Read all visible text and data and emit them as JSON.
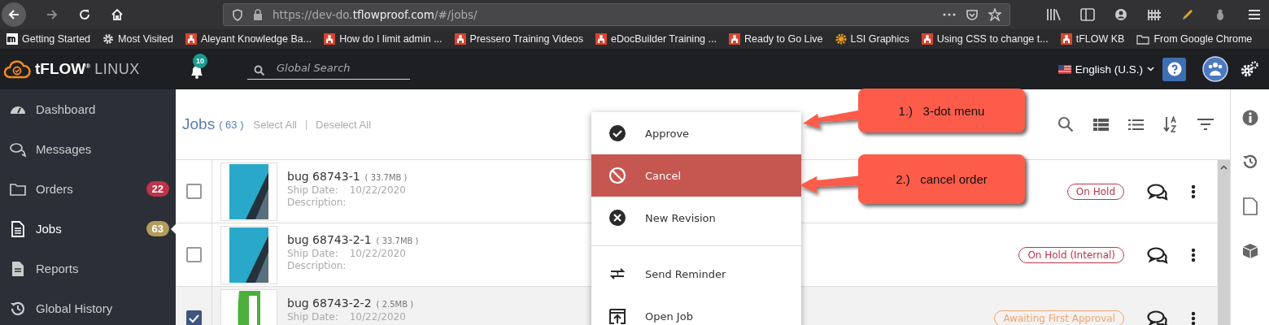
{
  "browser": {
    "url_prefix": "https://dev-do.",
    "url_domain": "tflowproof.com",
    "url_suffix": "/#/jobs/"
  },
  "bookmarks": [
    {
      "label": "Getting Started"
    },
    {
      "label": "Most Visited"
    },
    {
      "label": "Aleyant Knowledge Ba..."
    },
    {
      "label": "How do I limit admin ..."
    },
    {
      "label": "Pressero Training Videos"
    },
    {
      "label": "eDocBuilder Training ..."
    },
    {
      "label": "Ready to Go Live"
    },
    {
      "label": "LSI Graphics"
    },
    {
      "label": "Using CSS to change t..."
    },
    {
      "label": "tFLOW KB"
    },
    {
      "label": "From Google Chrome"
    }
  ],
  "app_header": {
    "logo": "tFLOW",
    "logo_mark": "®",
    "product": "LINUX",
    "notifications": "10",
    "search_placeholder": "Global Search",
    "language": "English (U.S.)"
  },
  "sidebar": {
    "items": [
      {
        "label": "Dashboard",
        "selected": false
      },
      {
        "label": "Messages",
        "selected": false
      },
      {
        "label": "Orders",
        "badge": "22",
        "color": "#c0334a",
        "selected": false
      },
      {
        "label": "Jobs",
        "badge": "63",
        "color": "#b39c5a",
        "selected": true
      },
      {
        "label": "Reports",
        "selected": false
      },
      {
        "label": "Global History",
        "selected": false
      }
    ]
  },
  "jobs": {
    "title": "Jobs",
    "count": "( 63 )",
    "select_all": "Select All",
    "separator": "|",
    "deselect_all": "Deselect All",
    "rows": [
      {
        "checked": false,
        "name": "bug 68743-1",
        "size": "( 33.7MB )",
        "ship_label": "Ship Date:",
        "ship_date": "10/22/2020",
        "description_label": "Description:",
        "status": "On Hold",
        "color": "#c0334a"
      },
      {
        "checked": false,
        "name": "bug 68743-2-1",
        "size": "( 33.7MB )",
        "ship_label": "Ship Date:",
        "ship_date": "10/22/2020",
        "description_label": "Description:",
        "status": "On Hold (Internal)",
        "color": "#c0334a"
      },
      {
        "checked": true,
        "name": "bug 68743-2-2",
        "size": "( 2.5MB )",
        "ship_label": "Ship Date:",
        "ship_date": "10/22/2020",
        "status": "Awaiting First Approval",
        "color": "#f2a46b"
      }
    ]
  },
  "menu": {
    "items": [
      {
        "label": "Approve",
        "selected": false
      },
      {
        "label": "Cancel",
        "selected": true
      },
      {
        "label": "New Revision",
        "selected": false
      },
      {
        "label": "Send Reminder",
        "selected": false
      },
      {
        "label": "Open Job",
        "selected": false
      }
    ]
  },
  "annotations": [
    {
      "number": "1.)",
      "text": "3-dot menu"
    },
    {
      "number": "2.)",
      "text": "cancel order"
    }
  ]
}
